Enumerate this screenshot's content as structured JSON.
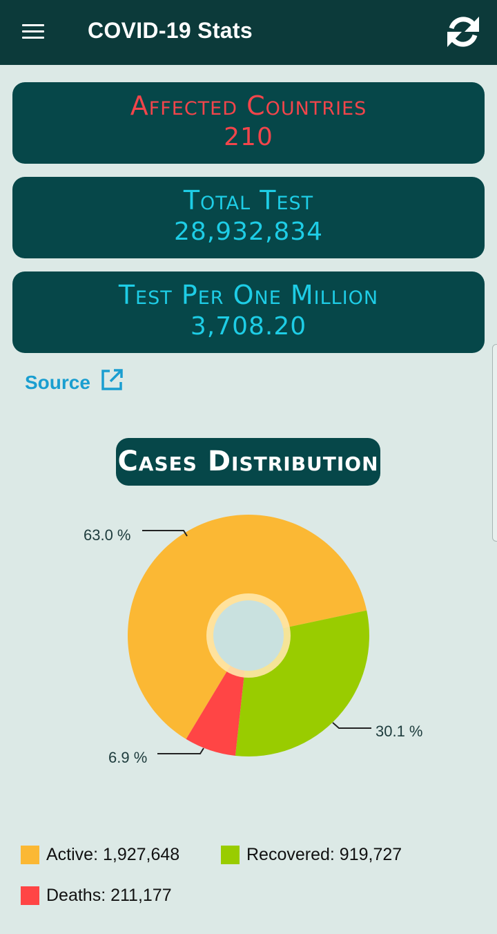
{
  "appbar": {
    "title": "COVID-19 Stats",
    "menu_icon": "hamburger-menu-icon",
    "refresh_icon": "refresh-icon"
  },
  "cards": [
    {
      "label": "Affected Countries",
      "value": "210",
      "color": "#f2454b"
    },
    {
      "label": "Total Test",
      "value": "28,932,834",
      "color": "#1ecde6"
    },
    {
      "label": "Test Per One Million",
      "value": "3,708.20",
      "color": "#1ecde6"
    }
  ],
  "source": {
    "label": "Source",
    "icon": "external-link-icon"
  },
  "distribution": {
    "title": "Cases Distribution",
    "percent_labels": {
      "active": "63.0 %",
      "recovered": "30.1 %",
      "deaths": "6.9 %"
    }
  },
  "legend": {
    "active": "Active:  1,927,648",
    "recovered": "Recovered:  919,727",
    "deaths": "Deaths:  211,177"
  },
  "chart_data": {
    "type": "pie",
    "categories": [
      "Active",
      "Recovered",
      "Deaths"
    ],
    "values": [
      1927648,
      919727,
      211177
    ],
    "percentages": [
      63.0,
      30.1,
      6.9
    ],
    "colors": [
      "#fbb834",
      "#99cc00",
      "#ff4545"
    ]
  }
}
